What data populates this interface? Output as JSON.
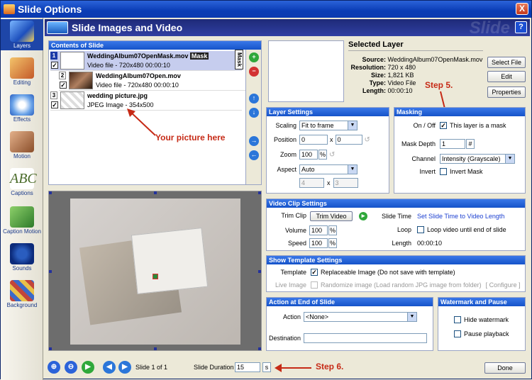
{
  "window": {
    "title": "Slide Options",
    "close_label": "X"
  },
  "header": {
    "title": "Slide Images and Video",
    "watermark": "Slide",
    "help_label": "?"
  },
  "sidebar": {
    "items": [
      {
        "label": "Layers"
      },
      {
        "label": "Editing"
      },
      {
        "label": "Effects"
      },
      {
        "label": "Motion"
      },
      {
        "label": "Captions"
      },
      {
        "label": "Caption Motion"
      },
      {
        "label": "Sounds"
      },
      {
        "label": "Background"
      }
    ]
  },
  "contents": {
    "header": "Contents of Slide",
    "mask_tab": "Mask",
    "layers": [
      {
        "num": "1",
        "name": "WeddingAlbum07OpenMask.mov",
        "badge": "Mask",
        "info": "Video file - 720x480 00:00:10",
        "checked": "✓"
      },
      {
        "num": "2",
        "name": "WeddingAlbum07Open.mov",
        "info": "Video file - 720x480 00:00:10",
        "checked": "✓"
      },
      {
        "num": "3",
        "name": "wedding picture.jpg",
        "info": "JPEG Image - 354x500",
        "checked": "✓"
      }
    ]
  },
  "annotations": {
    "picture": "Your picture here",
    "step5": "Step 5.",
    "step6": "Step 6."
  },
  "selected": {
    "title": "Selected Layer",
    "source_label": "Source:",
    "source": "WeddingAlbum07OpenMask.mov",
    "resolution_label": "Resolution:",
    "resolution": "720 x 480",
    "size_label": "Size:",
    "size": "1,821 KB",
    "type_label": "Type:",
    "type": "Video File",
    "length_label": "Length:",
    "length": "00:00:10",
    "select_file": "Select File",
    "edit": "Edit",
    "properties": "Properties"
  },
  "layer_settings": {
    "header": "Layer Settings",
    "scaling_label": "Scaling",
    "scaling": "Fit to frame",
    "position_label": "Position",
    "pos_x": "0",
    "pos_y": "0",
    "x_sep": "x",
    "zoom_label": "Zoom",
    "zoom": "100",
    "pct": "%",
    "aspect_label": "Aspect",
    "aspect": "Auto",
    "aspect_w": "4",
    "aspect_h": "3"
  },
  "masking": {
    "header": "Masking",
    "onoff_label": "On / Off",
    "is_mask_label": "This layer is a mask",
    "is_mask": "✓",
    "depth_label": "Mask Depth",
    "depth": "1",
    "depth_unit": "#",
    "channel_label": "Channel",
    "channel": "Intensity (Grayscale)",
    "invert_label": "Invert",
    "invert_check_label": "Invert Mask"
  },
  "video_clip": {
    "header": "Video Clip Settings",
    "trim_label": "Trim Clip",
    "trim_btn": "Trim Video",
    "slide_time_label": "Slide Time",
    "slide_time_link": "Set Slide Time to Video Length",
    "volume_label": "Volume",
    "volume": "100",
    "pct": "%",
    "loop_label": "Loop",
    "loop_check_label": "Loop video until end of slide",
    "speed_label": "Speed",
    "speed": "100",
    "length_label": "Length",
    "length": "00:00:10"
  },
  "template": {
    "header": "Show Template Settings",
    "template_label": "Template",
    "replaceable_label": "Replaceable Image (Do not save with template)",
    "replaceable": "✓",
    "live_label": "Live Image",
    "randomize_label": "Randomize image (Load random JPG image from folder)",
    "configure_label": "[ Configure ]"
  },
  "action_end": {
    "header": "Action at End of Slide",
    "action_label": "Action",
    "action": "<None>",
    "destination_label": "Destination",
    "destination": ""
  },
  "watermark": {
    "header": "Watermark and Pause",
    "hide_label": "Hide watermark",
    "pause_label": "Pause playback"
  },
  "bottom": {
    "slide_label": "Slide 1 of 1",
    "duration_label": "Slide Duration",
    "duration": "15",
    "duration_unit": "s",
    "done": "Done"
  }
}
